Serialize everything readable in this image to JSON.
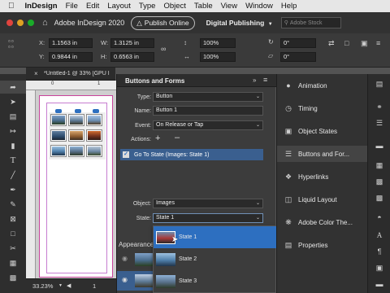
{
  "menubar": {
    "apple": "",
    "items": [
      "InDesign",
      "File",
      "Edit",
      "Layout",
      "Type",
      "Object",
      "Table",
      "View",
      "Window",
      "Help"
    ]
  },
  "appbar": {
    "title": "Adobe InDesign 2020",
    "publish": "Publish Online",
    "workspace": "Digital Publishing",
    "search_placeholder": "Adobe Stock"
  },
  "control": {
    "x_label": "X:",
    "x_val": "1.1563 in",
    "y_label": "Y:",
    "y_val": "0.9844 in",
    "w_label": "W:",
    "w_val": "1.3125 in",
    "h_label": "H:",
    "h_val": "0.6563 in",
    "scale_x": "100%",
    "scale_y": "100%",
    "angle": "0°",
    "shear": "0°"
  },
  "doc": {
    "tab": "*Untitled-1 @ 33% [GPU I",
    "ruler_zero": "0",
    "ruler_one": "1",
    "zoom": "33.23%",
    "page": "1"
  },
  "buttons_panel": {
    "title": "Buttons and Forms",
    "type_label": "Type:",
    "type_val": "Button",
    "name_label": "Name:",
    "name_val": "Button 1",
    "event_label": "Event:",
    "event_val": "On Release or Tap",
    "actions_label": "Actions:",
    "action_item": "Go To State (Images: State 1)",
    "object_label": "Object:",
    "object_val": "Images",
    "state_label": "State:",
    "state_val": "State 1",
    "appearance_label": "Appearance"
  },
  "dropdown": {
    "items": [
      "State 1",
      "State 2",
      "State 3"
    ]
  },
  "right_panels": [
    "Animation",
    "Timing",
    "Object States",
    "Buttons and For...",
    "Hyperlinks",
    "Liquid Layout",
    "Adobe Color The...",
    "Properties"
  ],
  "colors": {
    "accent": "#2d6fc0",
    "panel": "#3c3c3c",
    "selection": "#3a5f8f"
  }
}
